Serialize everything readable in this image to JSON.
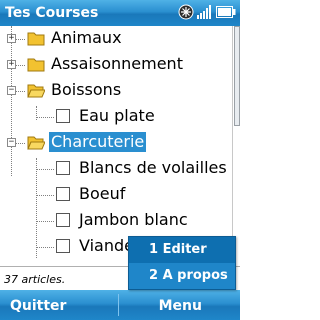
{
  "app": {
    "title": "Tes Courses"
  },
  "tree": {
    "items": [
      {
        "label": "Animaux",
        "kind": "folder",
        "state": "collapsed"
      },
      {
        "label": "Assaisonnement",
        "kind": "folder",
        "state": "collapsed"
      },
      {
        "label": "Boissons",
        "kind": "folder",
        "state": "expanded"
      },
      {
        "label": "Eau plate",
        "kind": "item",
        "checked": false
      },
      {
        "label": "Charcuterie",
        "kind": "folder",
        "state": "expanded",
        "selected": true
      },
      {
        "label": "Blancs de volailles",
        "kind": "item",
        "checked": false
      },
      {
        "label": "Boeuf",
        "kind": "item",
        "checked": false
      },
      {
        "label": "Jambon blanc",
        "kind": "item",
        "checked": false
      },
      {
        "label": "Viande",
        "kind": "item",
        "checked": false
      }
    ]
  },
  "status": {
    "text": "37 articles."
  },
  "softkeys": {
    "left": "Quitter",
    "right": "Menu"
  },
  "menu": {
    "items": [
      {
        "label": "1 Editer"
      },
      {
        "label": "2 A propos"
      }
    ]
  },
  "colors": {
    "accent": "#2a8fd0",
    "folder": "#f2c230"
  }
}
